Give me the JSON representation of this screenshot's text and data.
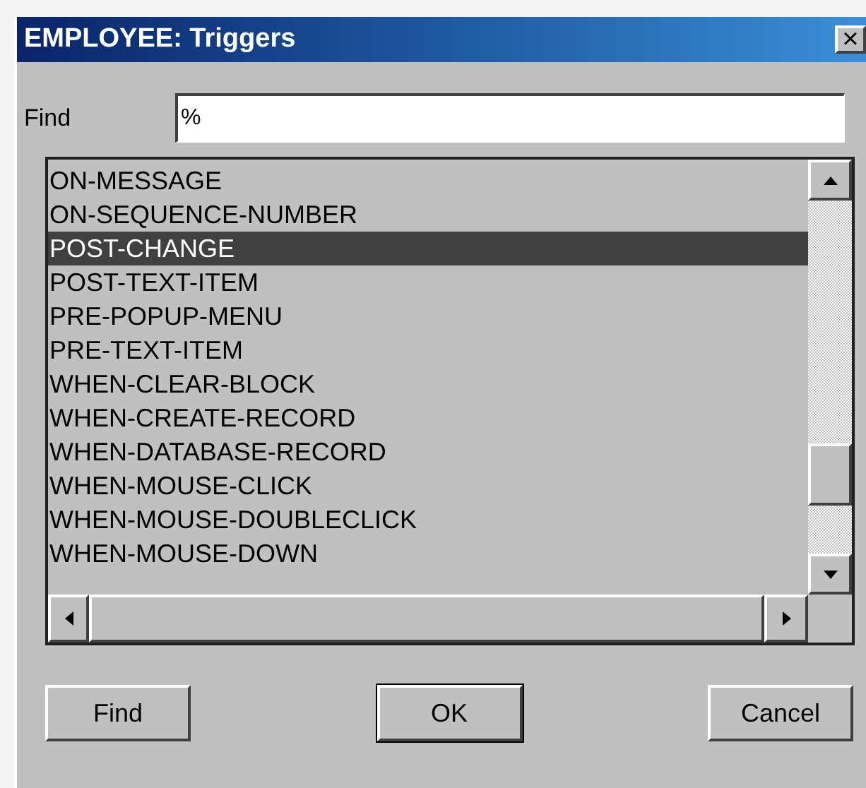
{
  "window": {
    "title": "EMPLOYEE: Triggers",
    "close": "×"
  },
  "find": {
    "label": "Find",
    "value": "%"
  },
  "list": {
    "items": [
      {
        "text": "ON-MESSAGE",
        "selected": false
      },
      {
        "text": "ON-SEQUENCE-NUMBER",
        "selected": false
      },
      {
        "text": "POST-CHANGE",
        "selected": true
      },
      {
        "text": "POST-TEXT-ITEM",
        "selected": false
      },
      {
        "text": "PRE-POPUP-MENU",
        "selected": false
      },
      {
        "text": "PRE-TEXT-ITEM",
        "selected": false
      },
      {
        "text": "WHEN-CLEAR-BLOCK",
        "selected": false
      },
      {
        "text": "WHEN-CREATE-RECORD",
        "selected": false
      },
      {
        "text": "WHEN-DATABASE-RECORD",
        "selected": false
      },
      {
        "text": "WHEN-MOUSE-CLICK",
        "selected": false
      },
      {
        "text": "WHEN-MOUSE-DOUBLECLICK",
        "selected": false
      },
      {
        "text": "WHEN-MOUSE-DOWN",
        "selected": false
      }
    ]
  },
  "buttons": [
    {
      "label": "Find",
      "default": false
    },
    {
      "label": "OK",
      "default": true
    },
    {
      "label": "Cancel",
      "default": false
    }
  ]
}
